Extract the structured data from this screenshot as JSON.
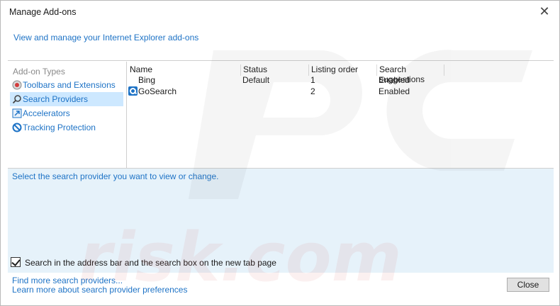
{
  "window": {
    "title": "Manage Add-ons",
    "close_glyph": "✕"
  },
  "header": {
    "link_text": "View and manage your Internet Explorer add-ons"
  },
  "sidebar": {
    "heading": "Add-on Types",
    "items": [
      {
        "label": "Toolbars and Extensions",
        "icon": "toolbar-extension-icon"
      },
      {
        "label": "Search Providers",
        "icon": "search-icon",
        "selected": true
      },
      {
        "label": "Accelerators",
        "icon": "accelerator-icon"
      },
      {
        "label": "Tracking Protection",
        "icon": "tracking-protection-icon"
      }
    ]
  },
  "list": {
    "columns": [
      "Name",
      "Status",
      "Listing order",
      "Search suggestions"
    ],
    "rows": [
      {
        "name": "Bing",
        "status": "Default",
        "order": "1",
        "suggestions": "Enabled",
        "icon": null
      },
      {
        "name": "GoSearch",
        "status": "",
        "order": "2",
        "suggestions": "Enabled",
        "icon": "gosearch-icon"
      }
    ]
  },
  "details": {
    "prompt": "Select the search provider you want to view or change.",
    "checkbox_label": "Search in the address bar and the search box on the new tab page",
    "checkbox_checked": true
  },
  "footer": {
    "links": [
      "Find more search providers...",
      "Learn more about search provider preferences"
    ],
    "close_label": "Close"
  },
  "colors": {
    "link": "#1e73c6",
    "selection": "#cde8ff",
    "details_bg": "#e6f2fa"
  },
  "watermark": "PC risk.com"
}
